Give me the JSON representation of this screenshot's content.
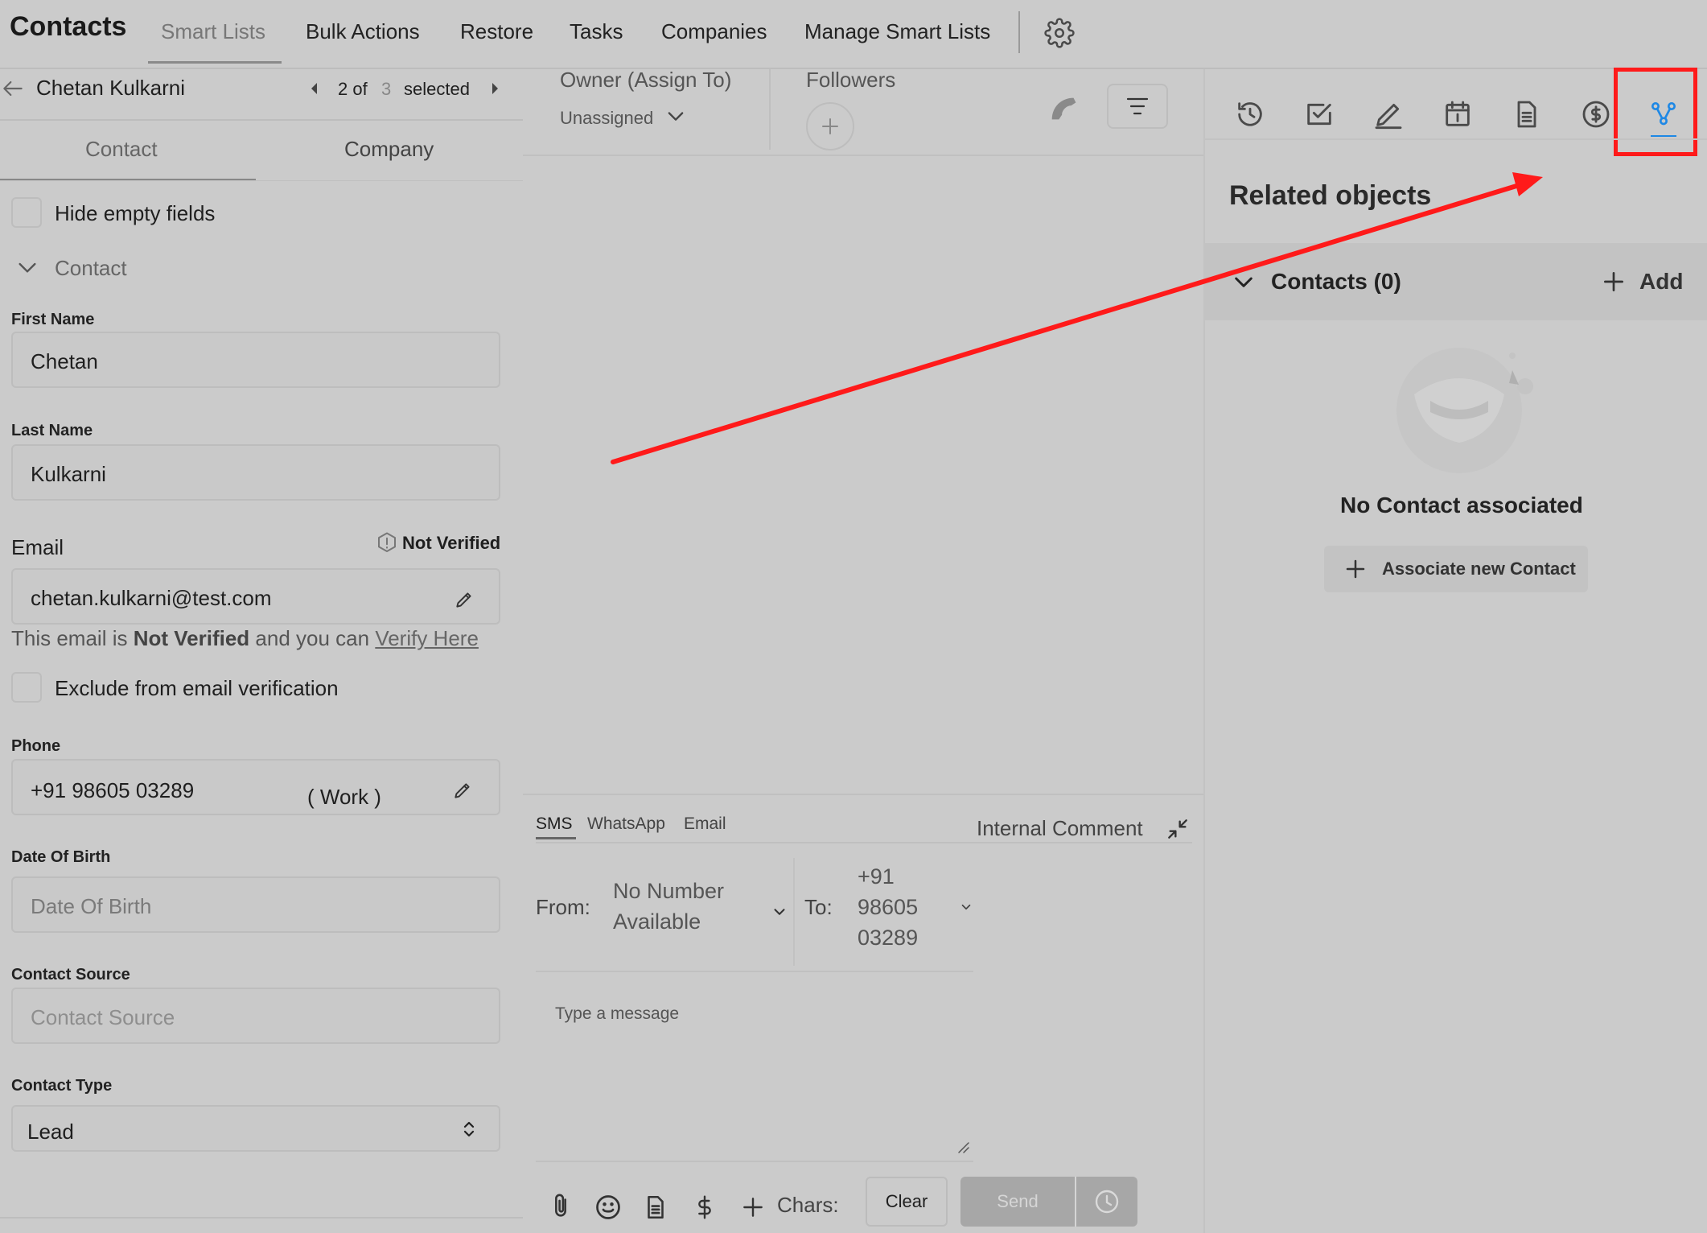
{
  "topnav": {
    "title": "Contacts",
    "tabs": [
      "Smart Lists",
      "Bulk Actions",
      "Restore",
      "Tasks",
      "Companies",
      "Manage Smart Lists"
    ]
  },
  "record": {
    "name": "Chetan Kulkarni",
    "index": "2 of",
    "total": "3",
    "selected_label": "selected"
  },
  "left_tabs": [
    "Contact",
    "Company"
  ],
  "hide_empty_label": "Hide empty fields",
  "section_title": "Contact",
  "fields": {
    "first_name": {
      "label": "First Name",
      "value": "Chetan"
    },
    "last_name": {
      "label": "Last Name",
      "value": "Kulkarni"
    },
    "email": {
      "label": "Email",
      "status": "Not Verified",
      "value": "chetan.kulkarni@test.com"
    },
    "phone": {
      "label": "Phone",
      "value": "+91 98605 03289",
      "type": "( Work )"
    },
    "dob": {
      "label": "Date Of Birth",
      "placeholder": "Date Of Birth"
    },
    "source": {
      "label": "Contact Source",
      "placeholder": "Contact Source"
    },
    "contact_type": {
      "label": "Contact Type",
      "value": "Lead"
    }
  },
  "email_notice": {
    "prefix": "This email is ",
    "bold": "Not Verified",
    "middle": " and you can ",
    "link": "Verify Here"
  },
  "exclude_label": "Exclude from email verification",
  "owner": {
    "label": "Owner (Assign To)",
    "value": "Unassigned"
  },
  "followers_label": "Followers",
  "composer": {
    "tabs": [
      "SMS",
      "WhatsApp",
      "Email"
    ],
    "internal_comment": "Internal Comment",
    "from_label": "From:",
    "from_value_1": "No Number",
    "from_value_2": "Available",
    "to_label": "To:",
    "to_value_1": "+91",
    "to_value_2": "98605",
    "to_value_3": "03289",
    "placeholder": "Type a message",
    "chars_label": "Chars:",
    "clear_label": "Clear",
    "send_label": "Send"
  },
  "related": {
    "title": "Related objects",
    "contacts_header": "Contacts (0)",
    "add_label": "Add",
    "empty_text": "No Contact associated",
    "associate_label": "Associate new Contact"
  },
  "colors": {
    "background": "#cbcbcb",
    "accent_blue": "#1e88e5",
    "annotation_red": "#ff1a1a"
  },
  "right_tools": [
    "history-icon",
    "task-check-icon",
    "pen-icon",
    "calendar-icon",
    "document-icon",
    "dollar-icon",
    "related-objects-icon"
  ]
}
